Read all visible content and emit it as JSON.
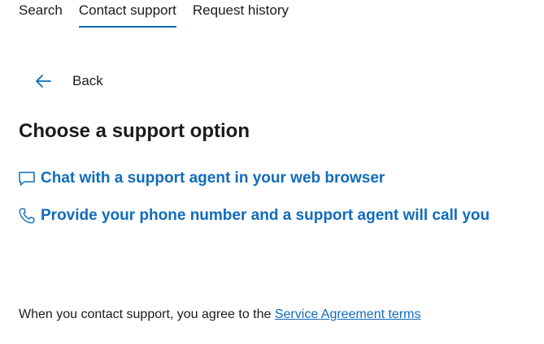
{
  "tabs": [
    {
      "label": "Search",
      "active": false
    },
    {
      "label": "Contact support",
      "active": true
    },
    {
      "label": "Request history",
      "active": false
    }
  ],
  "back": {
    "label": "Back",
    "icon": "arrow-left-icon"
  },
  "heading": "Choose a support option",
  "options": [
    {
      "label": "Chat with a support agent in your web browser",
      "icon": "chat-bubble-icon"
    },
    {
      "label": "Provide your phone number and a support agent will call you",
      "icon": "phone-icon"
    }
  ],
  "agreement": {
    "text": "When you contact support, you agree to the ",
    "link": "Service Agreement terms"
  },
  "colors": {
    "accent": "#0f6cbd",
    "text": "#1b1b1b",
    "background": "#ffffff"
  }
}
